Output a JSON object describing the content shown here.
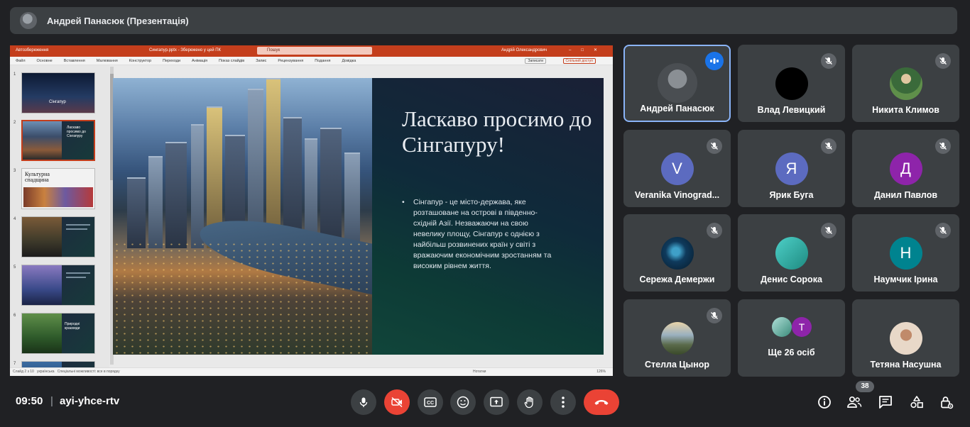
{
  "meeting": {
    "presenter_title": "Андрей Панасюк (Презентація)",
    "time": "09:50",
    "separator": "|",
    "code": "ayi-yhce-rtv",
    "participant_count": "38"
  },
  "powerpoint": {
    "autosave": "Автозбереження",
    "doc_title": "Сингапур.pptx - Збережено у цей ПК",
    "search_placeholder": "Пошук",
    "user": "Андрій Олександрович",
    "menu": [
      "Файл",
      "Основне",
      "Вставлення",
      "Малювання",
      "Конструктор",
      "Переходи",
      "Анімація",
      "Показ слайдів",
      "Запис",
      "Рецензування",
      "Подання",
      "Довідка"
    ],
    "notes_btn": "Записати",
    "share_btn": "Спільний доступ",
    "status_left": "Слайд 2 з 10",
    "status_lang": "українська",
    "status_access": "Спеціальні можливості: все в порядку",
    "status_notes": "Нотатки",
    "status_zoom": "126%",
    "thumbs": [
      {
        "num": "1",
        "label": "Сінгапур"
      },
      {
        "num": "2",
        "label": "Ласкаво просимо до Сінгапуру"
      },
      {
        "num": "3",
        "label": "Культурна спадщина"
      },
      {
        "num": "4",
        "label": ""
      },
      {
        "num": "5",
        "label": ""
      },
      {
        "num": "6",
        "label": "Природні краєвиди"
      },
      {
        "num": "7",
        "label": ""
      }
    ]
  },
  "slide": {
    "title": "Ласкаво просимо до Сінгапуру!",
    "body": "Сінгапур - це місто-держава, яке розташоване на острові в південно-східній Азії. Незважаючи на свою невелику площу, Сінгапур є однією з найбільш розвинених країн у світі з вражаючим економічним зростанням та високим рівнем життя."
  },
  "participants": [
    {
      "name": "Андрей Панасюк",
      "avatar": "",
      "color": "#6b6f73",
      "state": "speaking"
    },
    {
      "name": "Влад Левицкий",
      "avatar": "",
      "color": "#000000",
      "state": "muted"
    },
    {
      "name": "Никита Климов",
      "avatar": "",
      "color": "#4b7c4a",
      "state": "muted"
    },
    {
      "name": "Veranika Vinograd...",
      "avatar": "V",
      "color": "#5c6bc0",
      "state": "muted"
    },
    {
      "name": "Ярик Буга",
      "avatar": "Я",
      "color": "#5c6bc0",
      "state": "muted"
    },
    {
      "name": "Данил Павлов",
      "avatar": "Д",
      "color": "#8e24aa",
      "state": "muted"
    },
    {
      "name": "Сережа Демержи",
      "avatar": "",
      "color": "#0f3a5c",
      "state": "muted"
    },
    {
      "name": "Денис Сорока",
      "avatar": "",
      "color": "#26a69a",
      "state": "muted"
    },
    {
      "name": "Наумчик Ірина",
      "avatar": "Н",
      "color": "#00838f",
      "state": "muted"
    },
    {
      "name": "Стелла Цынор",
      "avatar": "",
      "color": "#7a8a6a",
      "state": "muted"
    },
    {
      "name": "Ще 26 осіб",
      "avatar": "Т",
      "color": "#8e24aa",
      "state": "more"
    },
    {
      "name": "Тетяна Насушна",
      "avatar": "",
      "color": "#c9b6a6",
      "state": "none"
    }
  ],
  "colors": {
    "bg": "#202124",
    "tile": "#3c4043",
    "red": "#ea4335",
    "accent": "#8ab4f8"
  },
  "icons": {
    "mic": "microphone-icon",
    "cam": "camera-off-icon",
    "cc": "captions-icon",
    "emoji": "emoji-icon",
    "present": "present-screen-icon",
    "hand": "raise-hand-icon",
    "more": "more-vert-icon",
    "hangup": "hang-up-icon",
    "info": "info-icon",
    "people": "people-icon",
    "chat": "chat-icon",
    "activities": "activities-icon",
    "lock": "host-controls-icon"
  }
}
